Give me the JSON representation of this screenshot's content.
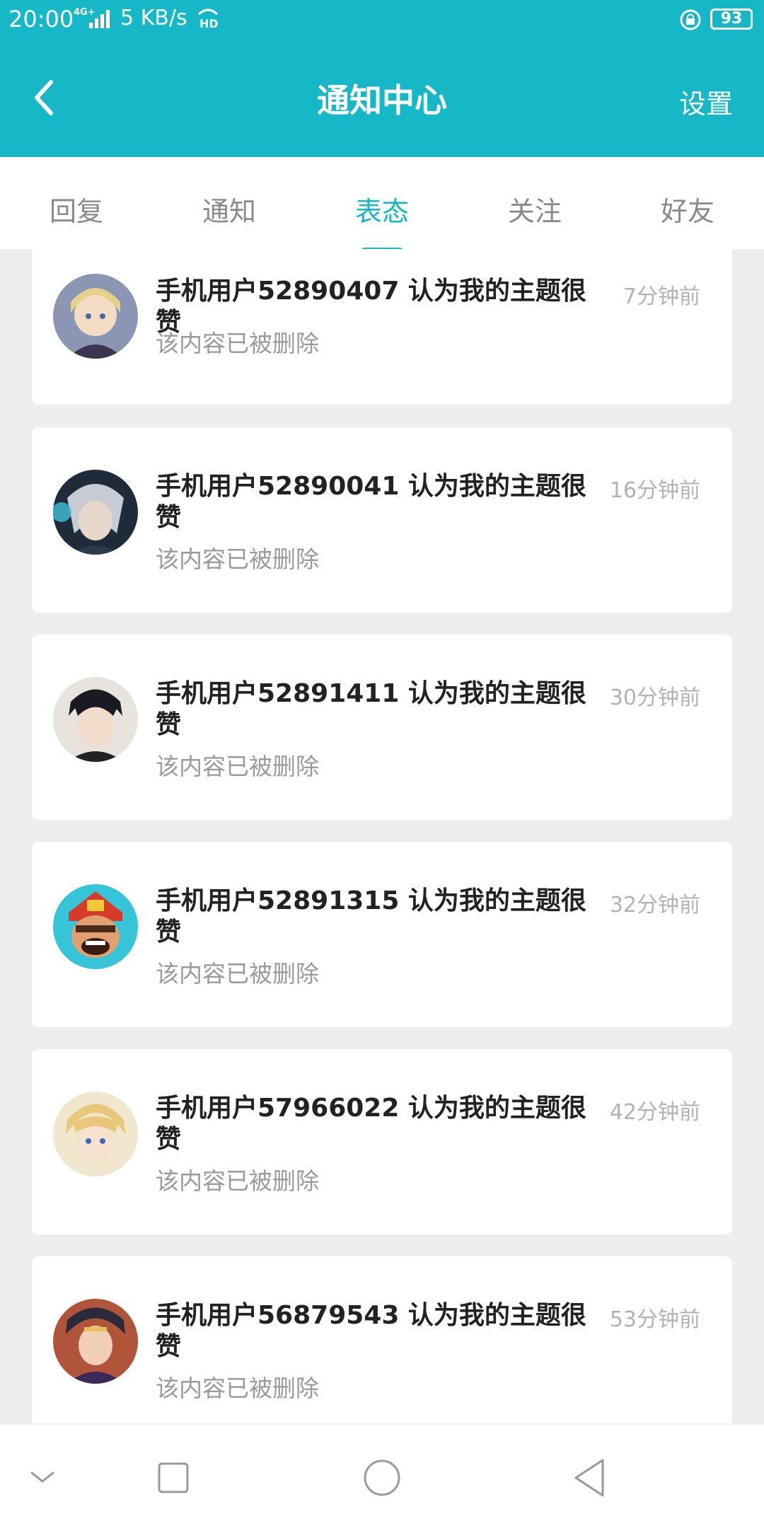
{
  "status_bar": {
    "time": "20:00",
    "network": "4G+",
    "speed": "5 KB/s",
    "hd": "HD",
    "battery": "93"
  },
  "header": {
    "title": "通知中心",
    "settings_label": "设置"
  },
  "tabs": [
    {
      "label": "回复",
      "active": false
    },
    {
      "label": "通知",
      "active": false
    },
    {
      "label": "表态",
      "active": true
    },
    {
      "label": "关注",
      "active": false
    },
    {
      "label": "好友",
      "active": false
    }
  ],
  "notifications": [
    {
      "line1": "手机用户52890407 认为我的主题很赞",
      "line2": "",
      "subtitle": "该内容已被删除",
      "time": "7分钟前"
    },
    {
      "line1": "手机用户52890041 认为我的主题很",
      "line2": "赞",
      "subtitle": "该内容已被删除",
      "time": "16分钟前"
    },
    {
      "line1": "手机用户52891411 认为我的主题很",
      "line2": "赞",
      "subtitle": "该内容已被删除",
      "time": "30分钟前"
    },
    {
      "line1": "手机用户52891315 认为我的主题很",
      "line2": "赞",
      "subtitle": "该内容已被删除",
      "time": "32分钟前"
    },
    {
      "line1": "手机用户57966022 认为我的主题很",
      "line2": "赞",
      "subtitle": "该内容已被删除",
      "time": "42分钟前"
    },
    {
      "line1": "手机用户56879543 认为我的主题很",
      "line2": "赞",
      "subtitle": "该内容已被删除",
      "time": "53分钟前"
    }
  ],
  "colors": {
    "accent": "#16b8c8",
    "background": "#eeeeee"
  }
}
